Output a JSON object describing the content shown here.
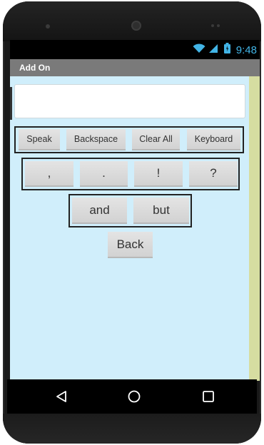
{
  "status": {
    "time": "9:48"
  },
  "app": {
    "title": "Add On"
  },
  "textbox": {
    "value": ""
  },
  "controls": {
    "speak": "Speak",
    "backspace": "Backspace",
    "clear_all": "Clear All",
    "keyboard": "Keyboard"
  },
  "punctuation": {
    "comma": ",",
    "period": ".",
    "exclamation": "!",
    "question": "?"
  },
  "conjunctions": {
    "and": "and",
    "but": "but"
  },
  "back_label": "Back",
  "colors": {
    "content_bg": "#d0eefb",
    "side_strip": "#d6dda1",
    "title_bar": "#7a7a7a",
    "status_accent": "#42b4e6"
  },
  "icons": {
    "wifi": "wifi-icon",
    "signal": "signal-icon",
    "battery": "battery-icon",
    "nav_back": "nav-back-icon",
    "nav_home": "nav-home-icon",
    "nav_recents": "nav-recents-icon"
  }
}
